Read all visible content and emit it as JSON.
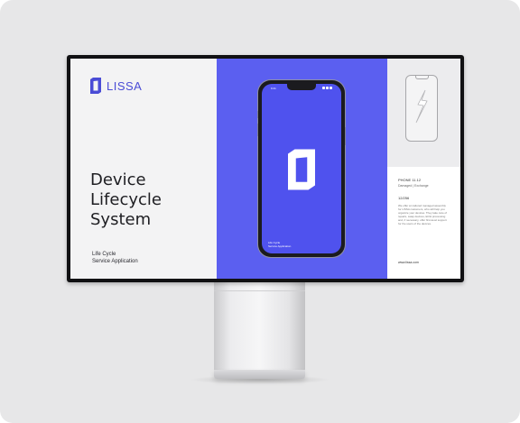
{
  "brand": {
    "name": "LISSA",
    "color": "#4a4cd6",
    "accent_panel_color": "#5b5ff0",
    "logo_icon": "lissa-logo-icon"
  },
  "hero": {
    "headline_lines": [
      "Device",
      "Lifecycle",
      "System"
    ],
    "subtitle_lines": [
      "Life Cycle",
      "Service Application"
    ]
  },
  "phone": {
    "status_time": "9:41",
    "caption_lines": [
      "Life Cycle",
      "Service Application"
    ]
  },
  "spec": {
    "title": "PHONE 11.12",
    "subtitle": "Damaged | Exchange",
    "count": "12/256",
    "body": "We offer an tailored managed assembly for LISSA customers, who will help you organize your devices. They take care of repairs, swap devices, EOH processing and, if necessary, offer first-level support for the users of the devices.",
    "url": "www.lissa.com"
  }
}
